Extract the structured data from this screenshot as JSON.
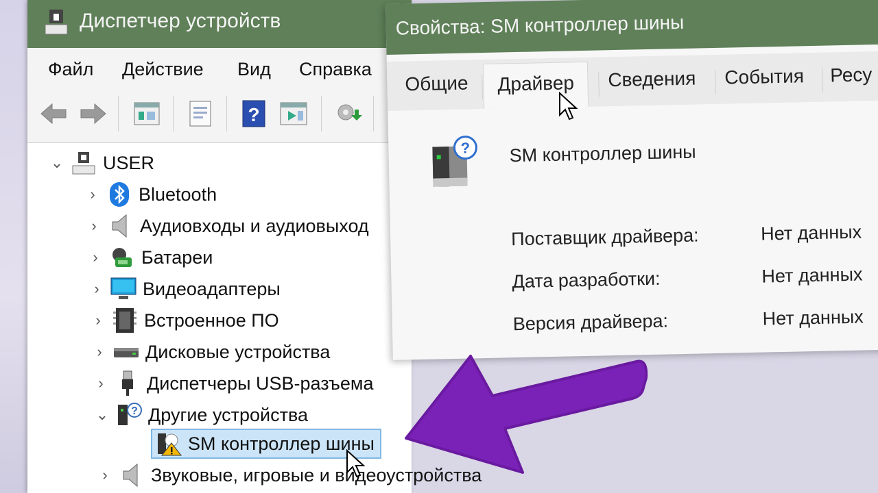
{
  "device_manager": {
    "title": "Диспетчер устройств",
    "menu": [
      "Файл",
      "Действие",
      "Вид",
      "Справка"
    ],
    "tree": {
      "root": "USER",
      "items": [
        "Bluetooth",
        "Аудиовходы и аудиовыход",
        "Батареи",
        "Видеоадаптеры",
        "Встроенное ПО",
        "Дисковые устройства",
        "Диспетчеры USB-разъема",
        "Другие устройства",
        "SM контроллер шины",
        "Звуковые, игровые и видеоустройства"
      ]
    }
  },
  "properties": {
    "title": "Свойства: SM контроллер шины",
    "tabs": [
      "Общие",
      "Драйвер",
      "Сведения",
      "События",
      "Ресу"
    ],
    "device_name": "SM контроллер шины",
    "fields": [
      {
        "label": "Поставщик драйвера:",
        "value": "Нет данных"
      },
      {
        "label": "Дата разработки:",
        "value": "Нет данных"
      },
      {
        "label": "Версия драйвера:",
        "value": "Нет данных"
      }
    ]
  },
  "colors": {
    "titlebar": "#5f8058",
    "selection": "#cce4f7",
    "arrow": "#7a22b8"
  },
  "icons": [
    "app-icon",
    "back-arrow-icon",
    "forward-arrow-icon",
    "bluetooth-icon",
    "speaker-icon",
    "battery-icon",
    "monitor-icon",
    "chip-icon",
    "disk-icon",
    "usb-icon",
    "unknown-device-icon",
    "warning-icon",
    "help-icon"
  ]
}
